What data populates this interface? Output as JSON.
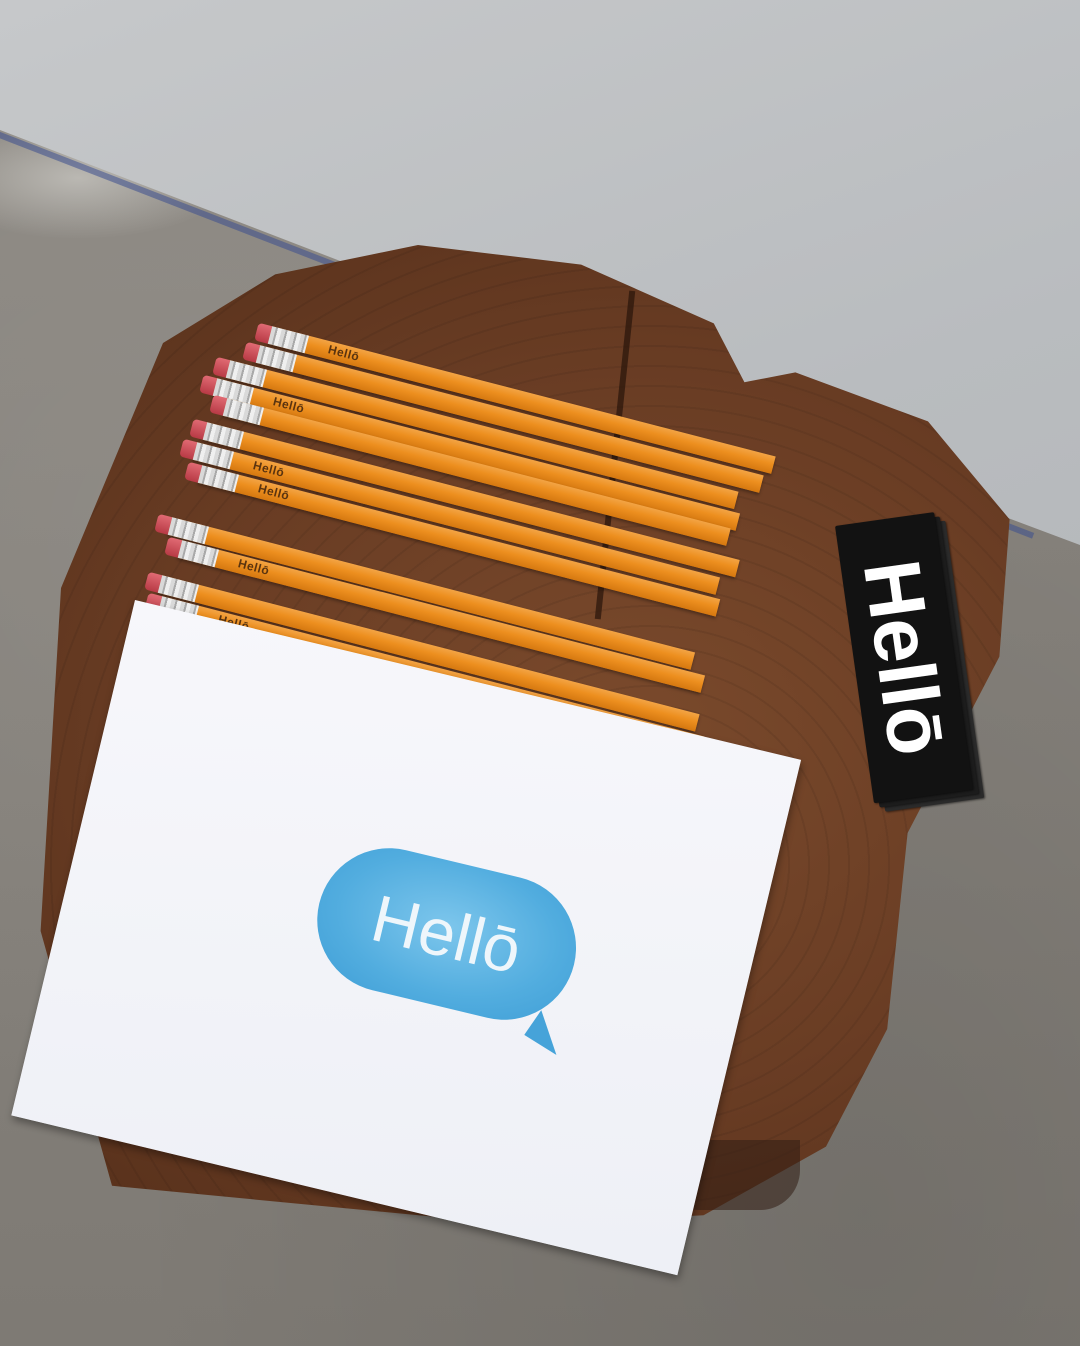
{
  "scene": {
    "pencil_brand": "Hellō",
    "card_text": "Hellō",
    "sticker_text": "Hellō",
    "pencil_count": 12
  },
  "colors": {
    "wall": "#b9bcbf",
    "floor": "#86827c",
    "stump": "#6a3d24",
    "pencil": "#ed8f1f",
    "card": "#f3f4f8",
    "bubble": "#52addf",
    "sticker": "#121212"
  }
}
